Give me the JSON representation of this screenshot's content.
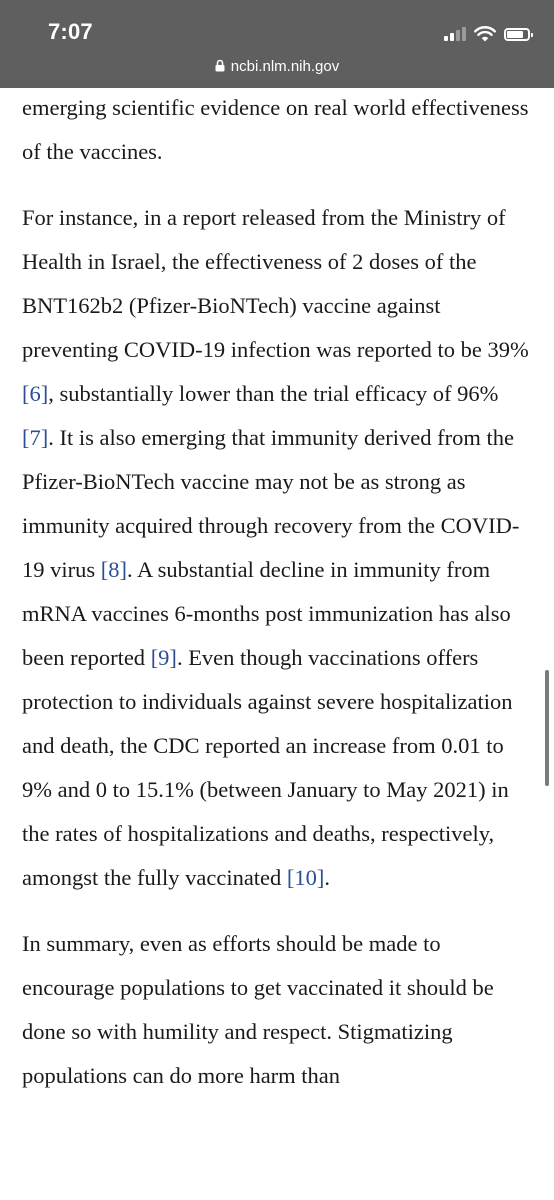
{
  "status_bar": {
    "time": "7:07",
    "battery_level": 0.82,
    "signal_bars_active": 2,
    "signal_bars_total": 4
  },
  "browser": {
    "url": "ncbi.nlm.nih.gov",
    "lock_icon": "lock-icon"
  },
  "colors": {
    "topbar_bg": "#5f5f5f",
    "reference_link": "#2a4f93",
    "text": "#1a1a1a"
  },
  "article": {
    "p1": {
      "t1": "emerging scientific evidence on real world effectiveness of the vaccines."
    },
    "p2": {
      "t1": "For instance, in a report released from the Ministry of Health in Israel, the effectiveness of 2 doses of the BNT162b2 (Pfizer-BioNTech) vaccine against preventing COVID-19 infection was reported to be 39% ",
      "r1": "[6]",
      "t2": ", substantially lower than the trial efficacy of 96% ",
      "r2": "[7]",
      "t3": ". It is also emerging that immunity derived from the Pfizer-BioNTech vaccine may not be as strong as immunity acquired through recovery from the COVID-19 virus ",
      "r3": "[8]",
      "t4": ". A substantial decline in immunity from mRNA vaccines 6-months post immunization has also been reported ",
      "r4": "[9]",
      "t5": ". Even though vaccinations offers protection to individuals against severe hospitalization and death, the CDC reported an increase from 0.01 to 9% and 0 to 15.1% (between January to May 2021) in the rates of hospitalizations and deaths, respectively, amongst the fully vaccinated ",
      "r5": "[10]",
      "t6": "."
    },
    "p3": {
      "t1": "In summary, even as efforts should be made to encourage populations to get vaccinated it should be done so with humility and respect. Stigmatizing populations can do more harm than"
    }
  }
}
